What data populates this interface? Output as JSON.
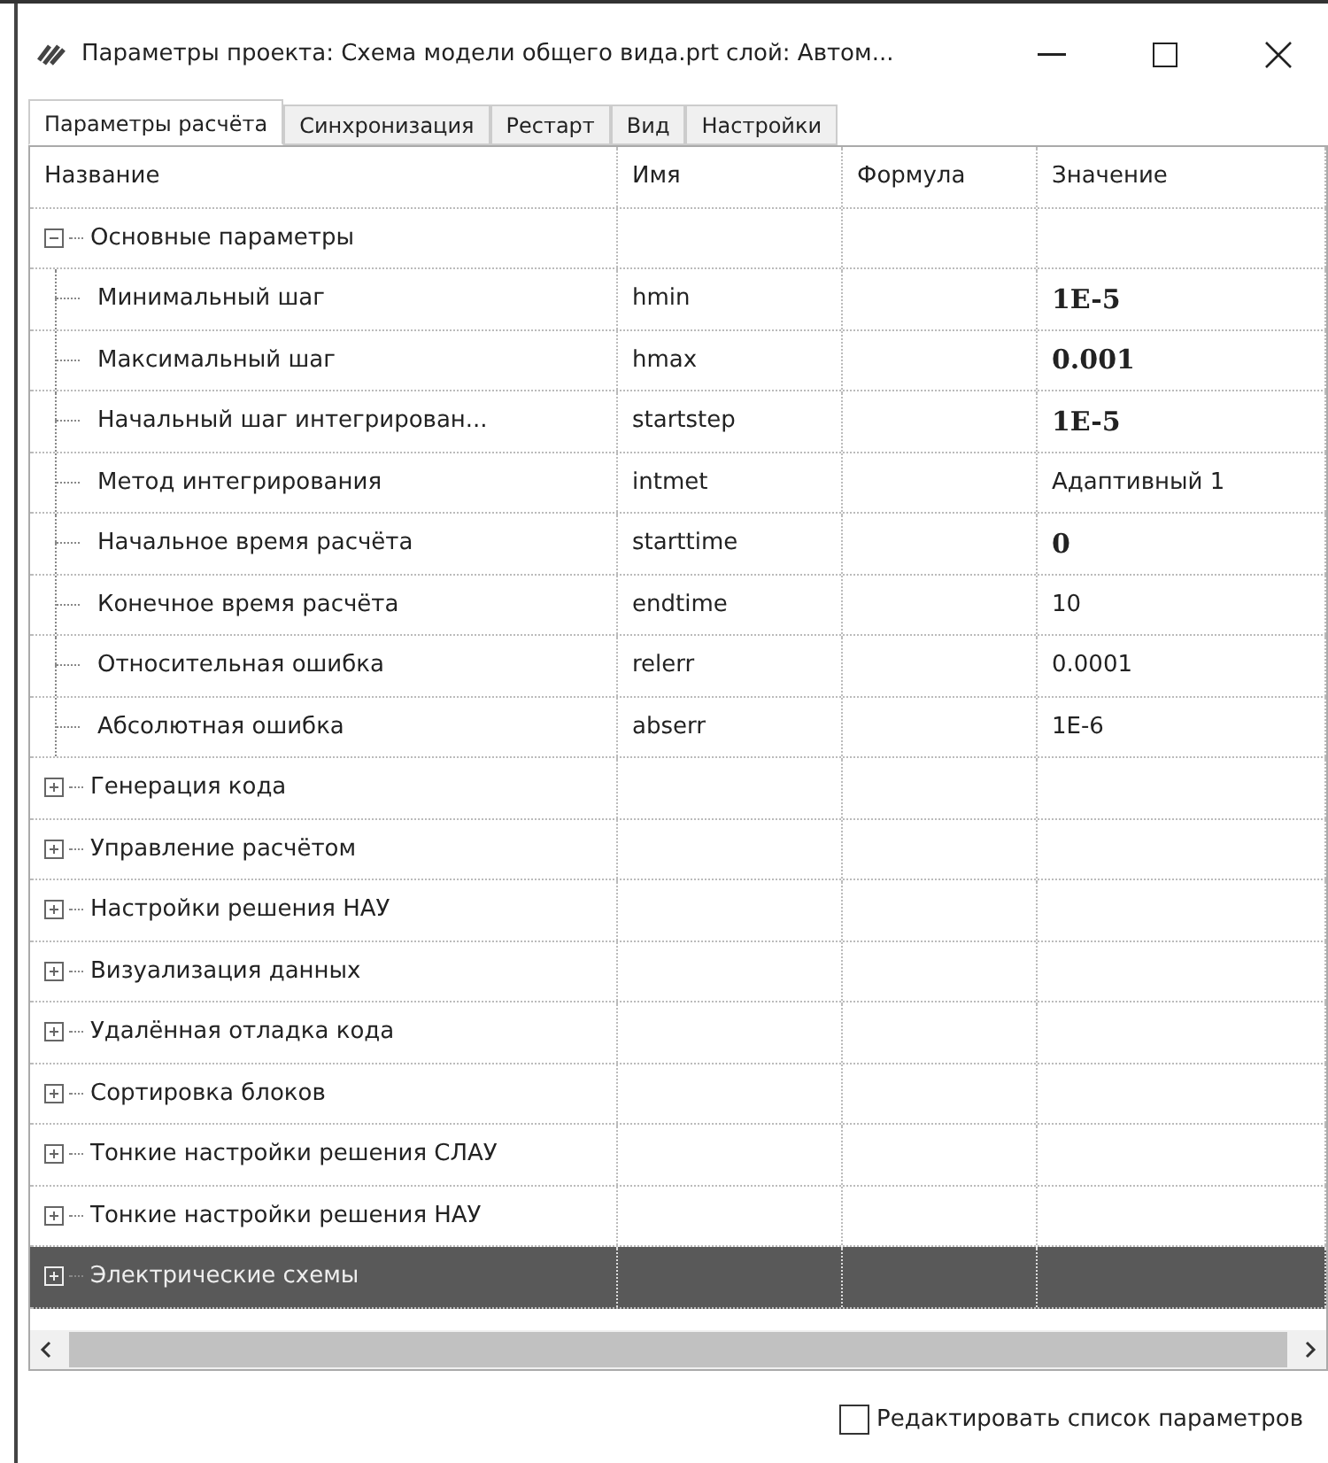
{
  "window": {
    "title": "Параметры проекта: Схема модели общего вида.prt  слой: Автом..."
  },
  "tabs": [
    {
      "label": "Параметры расчёта",
      "selected": true
    },
    {
      "label": "Синхронизация",
      "selected": false
    },
    {
      "label": "Рестарт",
      "selected": false
    },
    {
      "label": "Вид",
      "selected": false
    },
    {
      "label": "Настройки",
      "selected": false
    }
  ],
  "table": {
    "columns": [
      "Название",
      "Имя",
      "Формула",
      "Значение"
    ],
    "rows": [
      {
        "name": "Основные параметры",
        "expanded": true,
        "selected": false,
        "children": [
          {
            "name": "Минимальный шаг",
            "id": "hmin",
            "value": "1E-5",
            "bold": true
          },
          {
            "name": "Максимальный шаг",
            "id": "hmax",
            "value": "0.001",
            "bold": true
          },
          {
            "name": "Начальный шаг интегрирован...",
            "id": "startstep",
            "value": "1E-5",
            "bold": true
          },
          {
            "name": "Метод интегрирования",
            "id": "intmet",
            "value": "Адаптивный 1",
            "bold": false
          },
          {
            "name": "Начальное время расчёта",
            "id": "starttime",
            "value": "0",
            "bold": true
          },
          {
            "name": "Конечное время расчёта",
            "id": "endtime",
            "value": "10",
            "bold": false
          },
          {
            "name": "Относительная ошибка",
            "id": "relerr",
            "value": "0.0001",
            "bold": false
          },
          {
            "name": "Абсолютная ошибка",
            "id": "abserr",
            "value": "1E-6",
            "bold": false
          }
        ]
      },
      {
        "name": "Генерация кода",
        "expanded": false,
        "selected": false
      },
      {
        "name": "Управление расчётом",
        "expanded": false,
        "selected": false
      },
      {
        "name": "Настройки решения НАУ",
        "expanded": false,
        "selected": false
      },
      {
        "name": "Визуализация данных",
        "expanded": false,
        "selected": false
      },
      {
        "name": "Удалённая отладка кода",
        "expanded": false,
        "selected": false
      },
      {
        "name": "Сортировка блоков",
        "expanded": false,
        "selected": false
      },
      {
        "name": "Тонкие настройки решения СЛАУ",
        "expanded": false,
        "selected": false
      },
      {
        "name": "Тонкие настройки решения НАУ",
        "expanded": false,
        "selected": false
      },
      {
        "name": "Электрические схемы",
        "expanded": false,
        "selected": true
      }
    ]
  },
  "checkbox": {
    "label": "Редактировать список параметров",
    "checked": false
  }
}
